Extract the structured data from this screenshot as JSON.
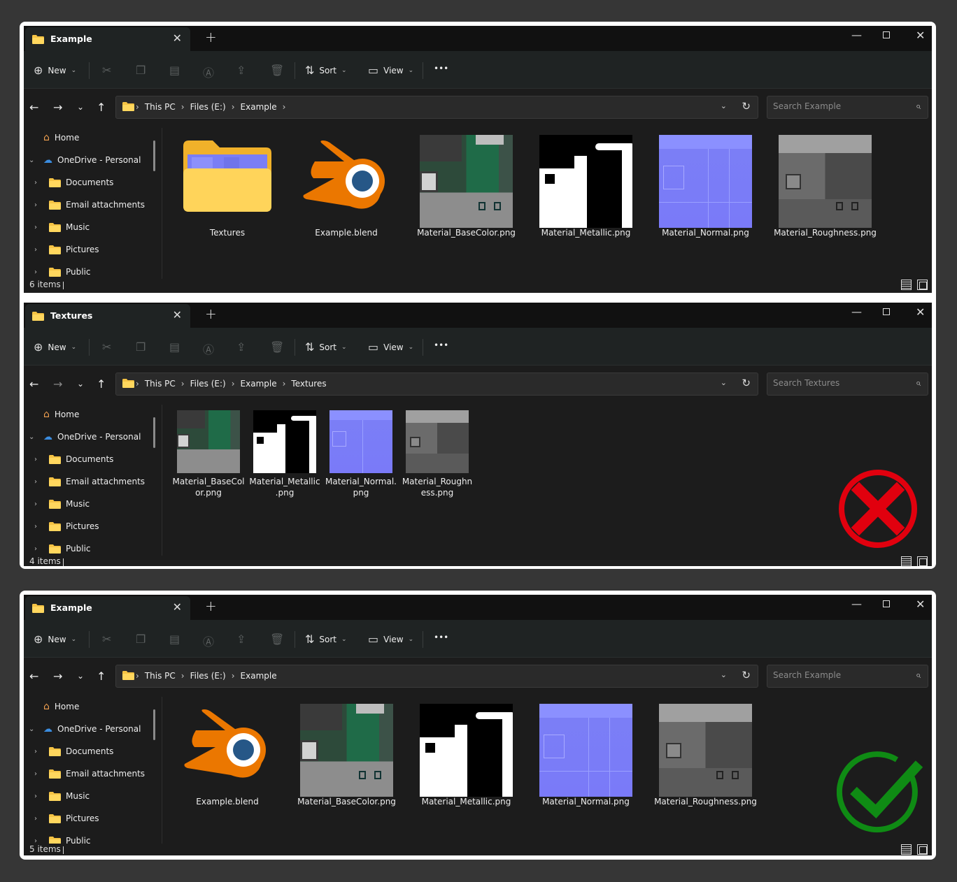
{
  "common": {
    "new_label": "New",
    "sort_label": "Sort",
    "view_label": "View",
    "more_label": "•••",
    "crumb_thispc": "This PC",
    "crumb_files": "Files (E:)",
    "crumb_example": "Example",
    "crumb_textures": "Textures",
    "sidebar": {
      "home": "Home",
      "onedrive": "OneDrive - Personal",
      "documents": "Documents",
      "email": "Email attachments",
      "music": "Music",
      "pictures": "Pictures",
      "public": "Public"
    }
  },
  "window1": {
    "tab_title": "Example",
    "search_placeholder": "Search Example",
    "status": "6 items",
    "files": [
      "Textures",
      "Example.blend",
      "Material_BaseColor.png",
      "Material_Metallic.png",
      "Material_Normal.png",
      "Material_Roughness.png"
    ]
  },
  "window2": {
    "tab_title": "Textures",
    "search_placeholder": "Search Textures",
    "status": "4 items",
    "files": [
      [
        "Material_BaseCol",
        "or.png"
      ],
      [
        "Material_Metallic",
        ".png"
      ],
      [
        "Material_Normal.",
        "png"
      ],
      [
        "Material_Roughn",
        "ess.png"
      ]
    ],
    "badge": "wrong"
  },
  "window3": {
    "tab_title": "Example",
    "search_placeholder": "Search Example",
    "status": "5 items",
    "files": [
      "Example.blend",
      "Material_BaseColor.png",
      "Material_Metallic.png",
      "Material_Normal.png",
      "Material_Roughness.png"
    ],
    "badge": "correct"
  },
  "colors": {
    "folder": "#f5c344",
    "blender_orange": "#eb7700",
    "blender_blue": "#265787",
    "wrong_red": "#e1000e",
    "correct_green": "#0f8b14"
  }
}
